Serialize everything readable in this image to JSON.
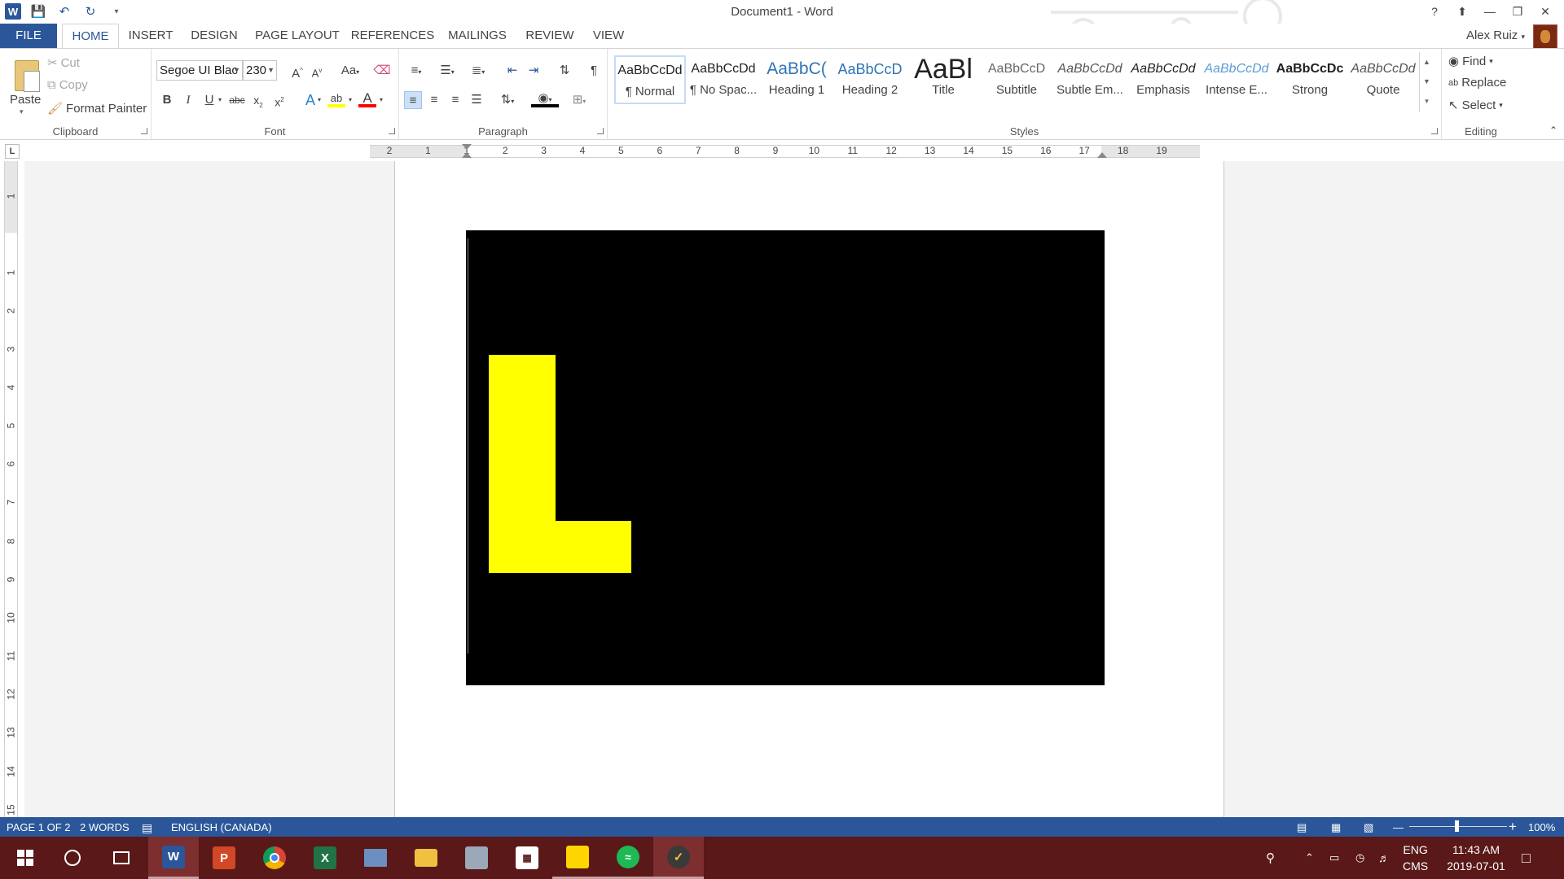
{
  "window": {
    "title": "Document1 - Word",
    "help": "?",
    "user": "Alex Ruiz"
  },
  "tabs": [
    "FILE",
    "HOME",
    "INSERT",
    "DESIGN",
    "PAGE LAYOUT",
    "REFERENCES",
    "MAILINGS",
    "REVIEW",
    "VIEW"
  ],
  "active_tab": "HOME",
  "clipboard": {
    "paste": "Paste",
    "cut": "Cut",
    "copy": "Copy",
    "format_painter": "Format Painter",
    "label": "Clipboard"
  },
  "font": {
    "name": "Segoe UI Blac",
    "size": "230",
    "change_case": "Aa",
    "label": "Font",
    "font_color": "#ff0000",
    "highlight_color": "#ffff00"
  },
  "paragraph": {
    "label": "Paragraph"
  },
  "styles": {
    "label": "Styles",
    "items": [
      {
        "preview": "AaBbCcDd",
        "label": "¶ Normal"
      },
      {
        "preview": "AaBbCcDd",
        "label": "¶ No Spac..."
      },
      {
        "preview": "AaBbC(",
        "label": "Heading 1"
      },
      {
        "preview": "AaBbCcD",
        "label": "Heading 2"
      },
      {
        "preview": "AaBl",
        "label": "Title"
      },
      {
        "preview": "AaBbCcD",
        "label": "Subtitle"
      },
      {
        "preview": "AaBbCcDd",
        "label": "Subtle Em..."
      },
      {
        "preview": "AaBbCcDd",
        "label": "Emphasis"
      },
      {
        "preview": "AaBbCcDd",
        "label": "Intense E..."
      },
      {
        "preview": "AaBbCcDc",
        "label": "Strong"
      },
      {
        "preview": "AaBbCcDd",
        "label": "Quote"
      }
    ]
  },
  "editing": {
    "find": "Find",
    "replace": "Replace",
    "select": "Select",
    "label": "Editing"
  },
  "ruler": {
    "h_labels": [
      "2",
      "1",
      "1",
      "2",
      "3",
      "4",
      "5",
      "6",
      "7",
      "8",
      "9",
      "10",
      "11",
      "12",
      "13",
      "14",
      "15",
      "16",
      "17",
      "18",
      "19"
    ],
    "v_labels": [
      "1",
      "1",
      "2",
      "3",
      "4",
      "5",
      "6",
      "7",
      "8",
      "9",
      "10",
      "11",
      "12",
      "13",
      "14",
      "15"
    ],
    "tab_selector": "L"
  },
  "document": {
    "background": "#000000",
    "shape_color": "#ffff00",
    "letter": "L"
  },
  "status": {
    "page": "PAGE 1 OF 2",
    "words": "2 WORDS",
    "language": "ENGLISH (CANADA)",
    "zoom": "100%"
  },
  "taskbar": {
    "lang": "ENG",
    "ime": "CMS",
    "time": "11:43 AM",
    "date": "2019-07-01"
  }
}
